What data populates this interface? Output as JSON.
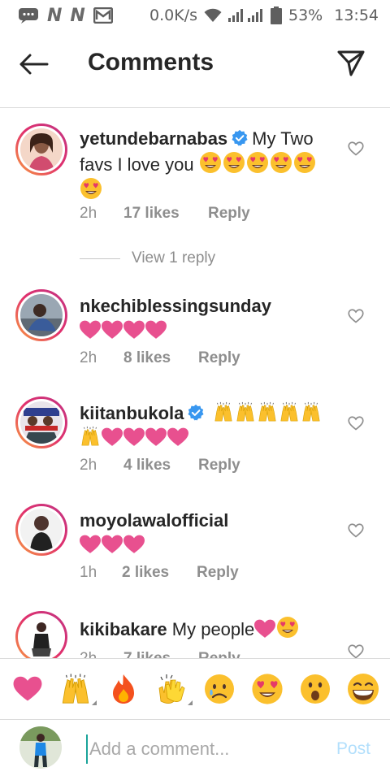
{
  "status_bar": {
    "carrier_icons": [
      "message-icon",
      "network-n-icon",
      "network-n-icon",
      "mail-icon"
    ],
    "speed": "0.0K/s",
    "battery": "53%",
    "time": "13:54"
  },
  "header": {
    "title": "Comments",
    "back_icon": "arrow-left-icon",
    "share_icon": "paper-plane-icon"
  },
  "comments": [
    {
      "username": "yetundebarnabas",
      "verified": true,
      "text_line1": "My Two",
      "text_line2": "favs I love you",
      "emoji": "heart-eyes x6",
      "time": "2h",
      "likes": "17 likes",
      "reply": "Reply",
      "view_replies": "View 1 reply"
    },
    {
      "username": "nkechiblessingsunday",
      "verified": false,
      "emoji": "pink-heart x4",
      "time": "2h",
      "likes": "8 likes",
      "reply": "Reply"
    },
    {
      "username": "kiitanbukola",
      "verified": true,
      "emoji": "raised-hands x6, pink-heart x4",
      "time": "2h",
      "likes": "4 likes",
      "reply": "Reply"
    },
    {
      "username": "moyolawalofficial",
      "verified": false,
      "emoji": "pink-heart x3",
      "time": "1h",
      "likes": "2 likes",
      "reply": "Reply"
    },
    {
      "username": "kikibakare",
      "verified": false,
      "text": "My people",
      "emoji": "pink-heart, heart-eyes",
      "time": "2h",
      "likes": "7 likes",
      "reply": "Reply"
    }
  ],
  "emoji_bar": [
    "pink-heart",
    "raised-hands",
    "fire",
    "clapping-hands",
    "sad-face",
    "heart-eyes",
    "surprised-face",
    "grinning-face"
  ],
  "compose": {
    "placeholder": "Add a comment...",
    "post_label": "Post"
  },
  "colors": {
    "accent_blue": "#b2dffc",
    "verified_blue": "#3897f0",
    "heart_pink": "#e8508f",
    "meta_gray": "#8e8e8e"
  }
}
